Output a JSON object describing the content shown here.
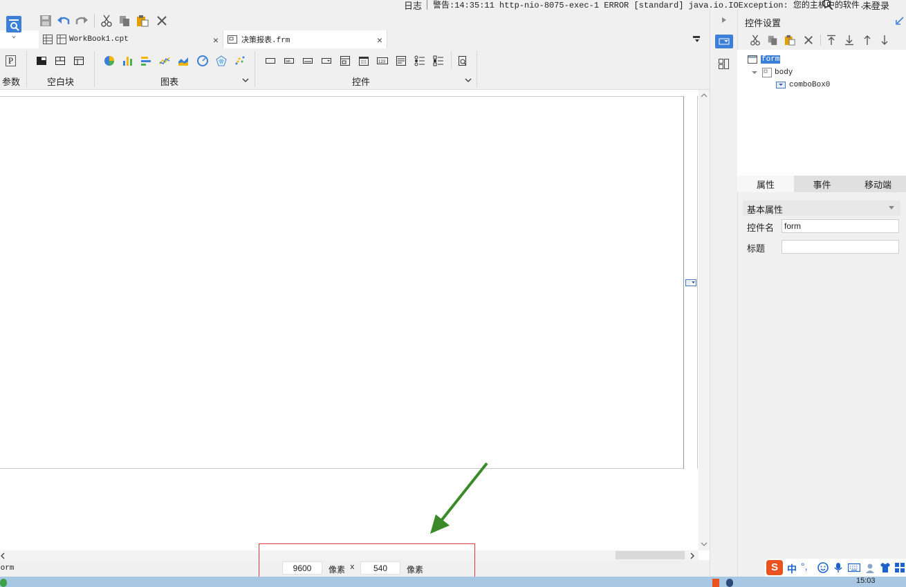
{
  "topbar": {
    "log_label": "日志",
    "warning_text": "警告:14:35:11 http-nio-8075-exec-1 ERROR [standard] java.io.IOException: 您的主机中的软件...",
    "login_label": "未登录"
  },
  "tabs": [
    {
      "label": "WorkBook1.cpt",
      "active": false
    },
    {
      "label": "决策报表.frm",
      "active": true
    }
  ],
  "ribbon": {
    "param_label": "参数",
    "blank_block_label": "空白块",
    "chart_label": "图表",
    "widget_label": "控件",
    "param_icon_text": "P"
  },
  "status": {
    "left_text": "form",
    "width_value": "9600",
    "height_value": "540",
    "unit": "像素",
    "times": "x"
  },
  "rpanel": {
    "title": "控件设置",
    "tree": {
      "root": "form",
      "body": "body",
      "combo": "comboBox0"
    },
    "tabs": [
      "属性",
      "事件",
      "移动端"
    ],
    "section": "基本属性",
    "props": {
      "name_label": "控件名",
      "name_value": "form",
      "title_label": "标题",
      "title_value": ""
    }
  },
  "taskbar": {
    "clock": "15:03",
    "ime_cn": "中"
  },
  "colors": {
    "accent": "#3c7fd6",
    "alert_box": "#e0393b",
    "arrow": "#3a8a2a"
  }
}
